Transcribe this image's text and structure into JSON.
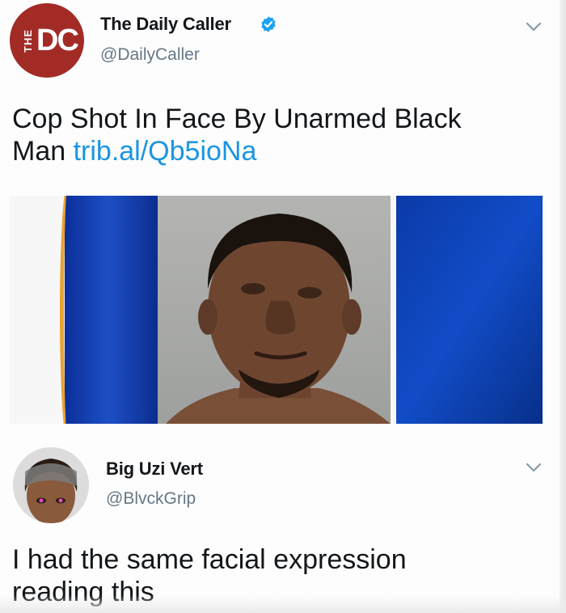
{
  "tweets": [
    {
      "author_name": "The Daily Caller",
      "author_handle": "@DailyCaller",
      "verified": true,
      "avatar_text_small": "THE",
      "avatar_text_large": "DC",
      "text": "Cop Shot In Face By Unarmed Black",
      "text_line2": "Man",
      "link": "trib.al/Qb5ioNa"
    },
    {
      "author_name": "Big Uzi Vert",
      "author_handle": "@BlvckGrip",
      "verified": false,
      "text": "I had the same facial expression",
      "text_line2": "reading this"
    }
  ],
  "colors": {
    "brand_red": "#a32b26",
    "verified_blue": "#1da1f2",
    "link_blue": "#1b95e0",
    "handle_gray": "#657786",
    "news_blue": "#114cc7"
  },
  "icons": {
    "verified": "verified-badge-icon",
    "menu": "chevron-down-icon"
  }
}
